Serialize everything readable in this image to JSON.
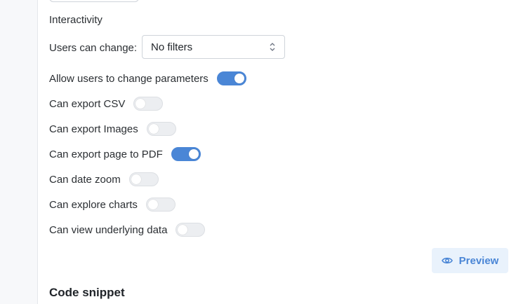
{
  "interactivity": {
    "title": "Interactivity",
    "users_can_change_label": "Users can change:",
    "users_can_change_value": "No filters"
  },
  "toggles": [
    {
      "label": "Allow users to change parameters",
      "on": true
    },
    {
      "label": "Can export CSV",
      "on": false
    },
    {
      "label": "Can export Images",
      "on": false
    },
    {
      "label": "Can export page to PDF",
      "on": true
    },
    {
      "label": "Can date zoom",
      "on": false
    },
    {
      "label": "Can explore charts",
      "on": false
    },
    {
      "label": "Can view underlying data",
      "on": false
    }
  ],
  "preview_button": {
    "label": "Preview",
    "icon": "eye-icon"
  },
  "code_snippet": {
    "title": "Code snippet"
  },
  "colors": {
    "accent": "#4a86d6",
    "accent_bg": "#e9f2fc",
    "toggle_off": "#eceef1"
  }
}
